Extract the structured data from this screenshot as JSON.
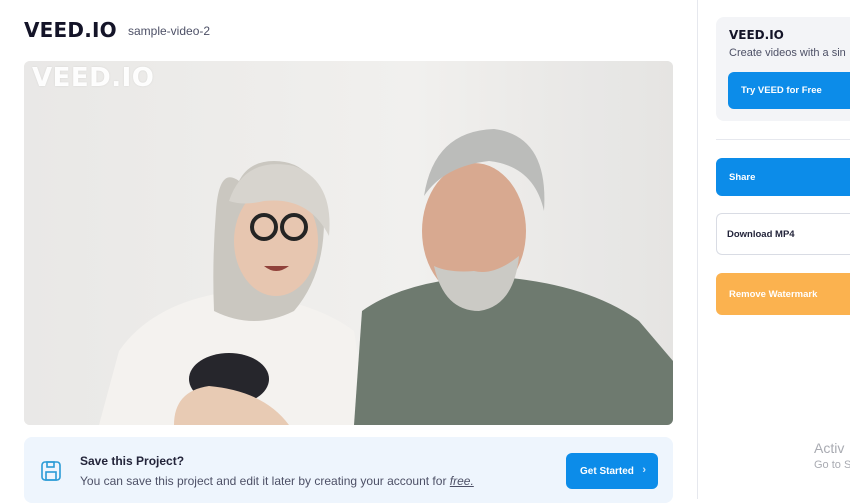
{
  "header": {
    "logo": "VEED.IO",
    "project_name": "sample-video-2"
  },
  "video": {
    "watermark": "VEED.IO"
  },
  "save_bar": {
    "title": "Save this Project?",
    "text": "You can save this project and edit it later by creating your account for ",
    "free_link": "free.",
    "button_label": "Get Started",
    "icon": "save-icon"
  },
  "sidebar": {
    "promo_title": "VEED.IO",
    "promo_subtitle": "Create videos with a sin",
    "try_button": "Try VEED for Free",
    "share_button": "Share",
    "download_button": "Download MP4",
    "remove_watermark_button": "Remove Watermark"
  },
  "os_overlay": {
    "line1": "Activ",
    "line2": "Go to S"
  },
  "colors": {
    "accent": "#0c8ce9",
    "watermark_button": "#fbb24f",
    "save_bar_bg": "#eef5fd"
  }
}
